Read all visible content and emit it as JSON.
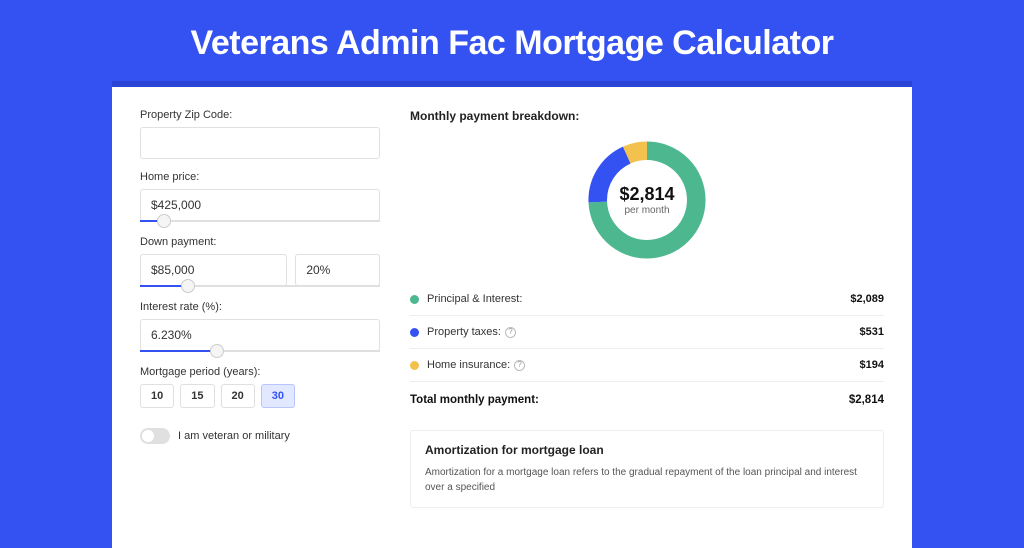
{
  "title": "Veterans Admin Fac Mortgage Calculator",
  "form": {
    "zip_label": "Property Zip Code:",
    "zip_value": "",
    "home_price_label": "Home price:",
    "home_price_value": "$425,000",
    "down_payment_label": "Down payment:",
    "down_payment_value": "$85,000",
    "down_payment_pct": "20%",
    "interest_rate_label": "Interest rate (%):",
    "interest_rate_value": "6.230%",
    "period_label": "Mortgage period (years):",
    "periods": {
      "p10": "10",
      "p15": "15",
      "p20": "20",
      "p30": "30"
    },
    "veteran_toggle_label": "I am veteran or military"
  },
  "breakdown": {
    "title": "Monthly payment breakdown:",
    "center_amount": "$2,814",
    "center_sub": "per month",
    "rows": {
      "pi": {
        "label": "Principal & Interest:",
        "value": "$2,089"
      },
      "taxes": {
        "label": "Property taxes:",
        "value": "$531"
      },
      "insurance": {
        "label": "Home insurance:",
        "value": "$194"
      }
    },
    "total_label": "Total monthly payment:",
    "total_value": "$2,814"
  },
  "amortization": {
    "title": "Amortization for mortgage loan",
    "text": "Amortization for a mortgage loan refers to the gradual repayment of the loan principal and interest over a specified"
  },
  "chart_data": {
    "type": "pie",
    "title": "Monthly payment breakdown",
    "categories": [
      "Principal & Interest",
      "Property taxes",
      "Home insurance"
    ],
    "values": [
      2089,
      531,
      194
    ],
    "colors": [
      "#4db78f",
      "#3352f1",
      "#f3c24e"
    ],
    "total": 2814
  }
}
